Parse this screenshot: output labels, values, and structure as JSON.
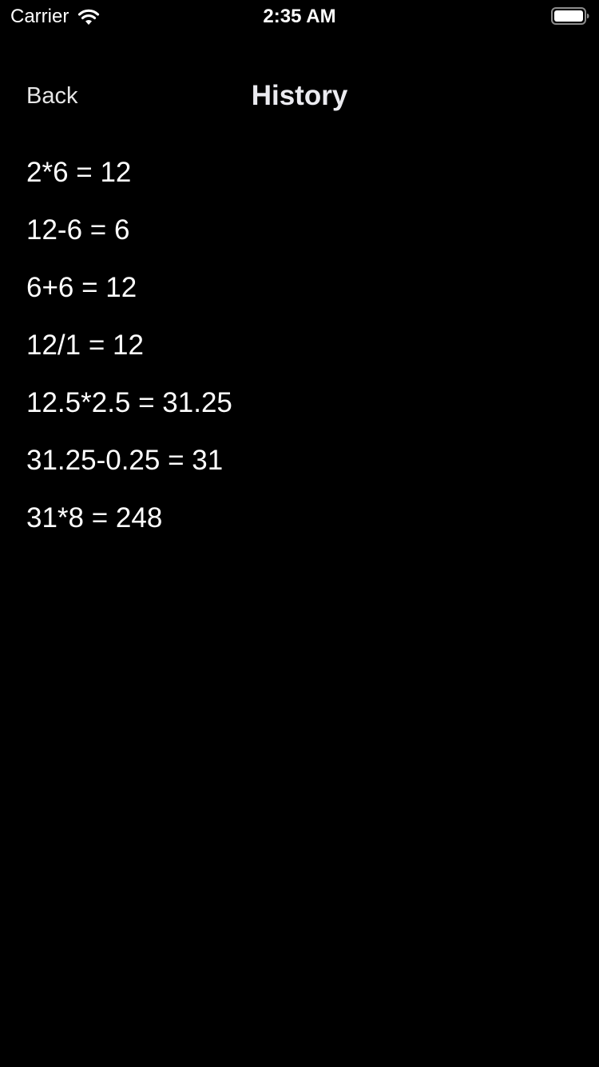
{
  "status_bar": {
    "carrier": "Carrier",
    "time": "2:35 AM",
    "wifi_icon": "wifi-icon",
    "battery_icon": "battery-full-icon"
  },
  "nav": {
    "back_label": "Back",
    "title": "History"
  },
  "history": [
    "2*6 = 12",
    "12-6 = 6",
    "6+6 = 12",
    "12/1 = 12",
    "12.5*2.5 = 31.25",
    "31.25-0.25 = 31",
    "31*8 = 248"
  ],
  "colors": {
    "background": "#000000",
    "text": "#ffffff",
    "title": "#ebebf0"
  }
}
